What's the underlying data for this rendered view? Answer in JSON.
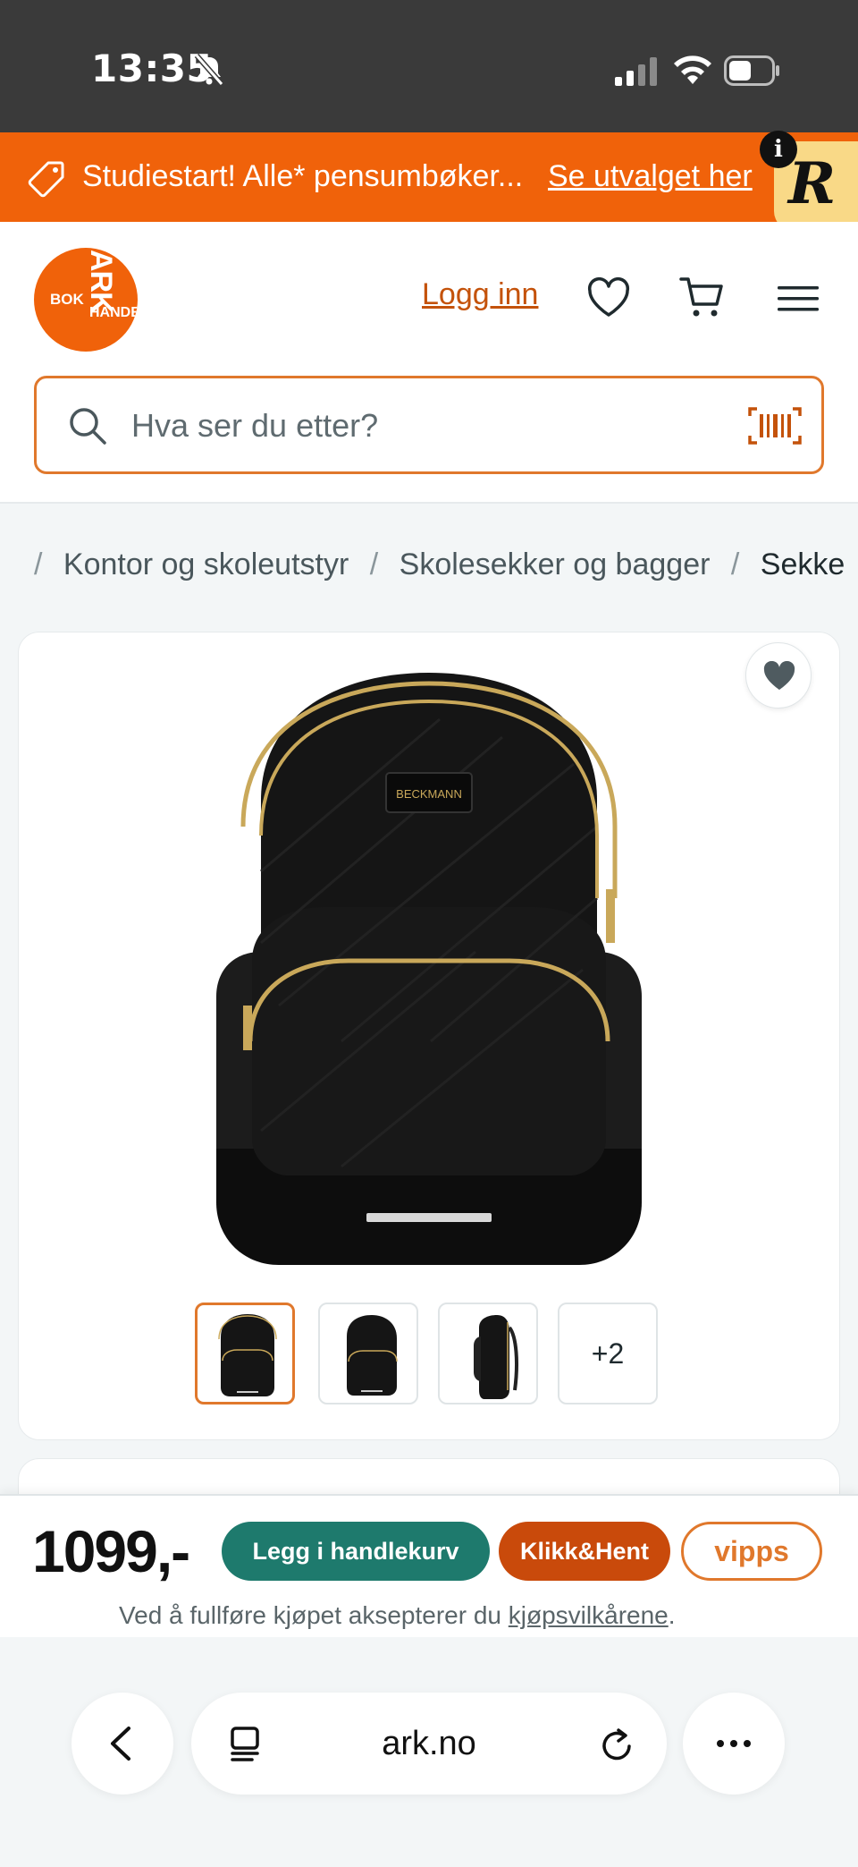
{
  "status_bar": {
    "time": "13:35"
  },
  "promo": {
    "text": "Studiestart! Alle* pensumbøker...",
    "link": "Se utvalget her",
    "info_badge": "i",
    "r_badge": "R"
  },
  "header": {
    "logo_text": "ARK",
    "logo_sub_1": "BOK",
    "logo_sub_2": "HANDEL",
    "login": "Logg inn"
  },
  "search": {
    "placeholder": "Hva ser du etter?"
  },
  "breadcrumb": [
    "Kontor og skoleutstyr",
    "Skolesekker og bagger",
    "Sekke"
  ],
  "product": {
    "brand_label": "BECKMANN",
    "more_images": "+2"
  },
  "purchase": {
    "price": "1099,-",
    "add_to_cart": "Legg i handlekurv",
    "click_collect": "Klikk&Hent",
    "vipps": "vipps",
    "terms_prefix": "Ved å fullføre kjøpet aksepterer du ",
    "terms_link": "kjøpsvilkårene",
    "terms_suffix": "."
  },
  "browser": {
    "url": "ark.no"
  },
  "colors": {
    "brand_orange": "#f0620a",
    "cart_green": "#1e7a6d",
    "klikk_orange": "#c94a0b"
  },
  "icons": [
    "bell-off-icon",
    "signal-icon",
    "wifi-icon",
    "battery-icon",
    "tag-icon",
    "heart-icon",
    "cart-icon",
    "menu-icon",
    "search-icon",
    "barcode-icon",
    "back-icon",
    "reader-icon",
    "reload-icon",
    "more-icon"
  ]
}
